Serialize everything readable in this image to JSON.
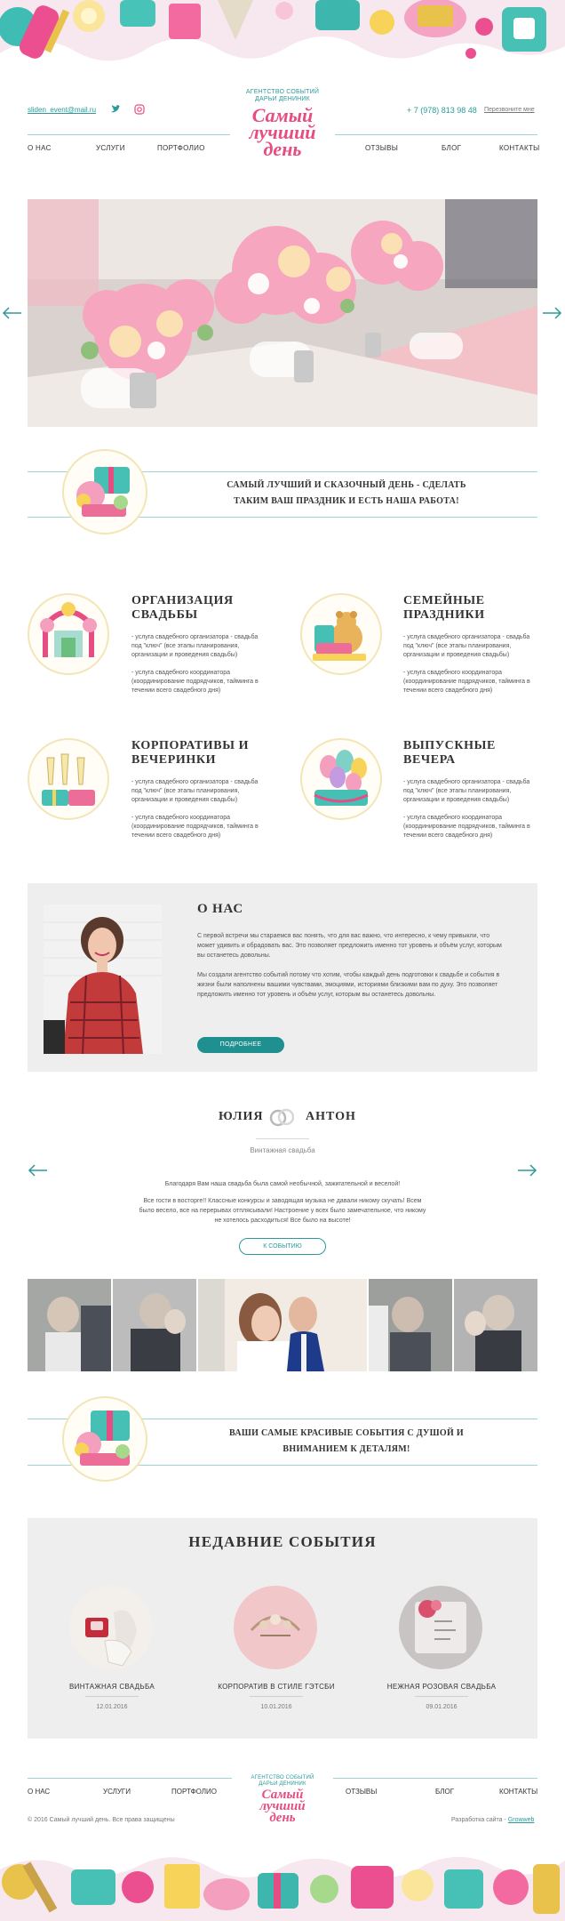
{
  "header": {
    "email": "sliden_event@mail.ru",
    "phone": "+ 7 (978) 813 98 48",
    "callback": "Перезвоните мне",
    "logo_top": "АГЕНТСТВО СОБЫТИЙ",
    "logo_sub": "ДАРЬИ ДЕНИНИК",
    "logo_line1": "Самый",
    "logo_line2": "лучший",
    "logo_line3": "день",
    "nav": [
      "О НАС",
      "УСЛУГИ",
      "ПОРТФОЛИО",
      "ОТЗЫВЫ",
      "БЛОГ",
      "КОНТАКТЫ"
    ]
  },
  "banner1": {
    "line1": "САМЫЙ ЛУЧШИЙ И СКАЗОЧНЫЙ ДЕНЬ - СДЕЛАТЬ",
    "line2": "ТАКИМ ВАШ ПРАЗДНИК И ЕСТЬ НАША РАБОТА!"
  },
  "services": [
    {
      "title1": "ОРГАНИЗАЦИЯ",
      "title2": "СВАДЬБЫ",
      "p1": "- услуга свадебного организатора - свадьба под \"ключ\" (все этапы планирования, организации и проведения свадьбы)",
      "p2": "- услуга свадебного координатора (координирование подрядчиков, тайминга в течении всего свадебного дня)"
    },
    {
      "title1": "СЕМЕЙНЫЕ",
      "title2": "ПРАЗДНИКИ",
      "p1": "- услуга свадебного организатора - свадьба под \"ключ\" (все этапы планирования, организации и проведения свадьбы)",
      "p2": "- услуга свадебного координатора (координирование подрядчиков, тайминга в течении всего свадебного дня)"
    },
    {
      "title1": "КОРПОРАТИВЫ И",
      "title2": "ВЕЧЕРИНКИ",
      "p1": "- услуга свадебного организатора - свадьба под \"ключ\" (все этапы планирования, организации и проведения свадьбы)",
      "p2": "- услуга свадебного координатора (координирование подрядчиков, тайминга в течении всего свадебного дня)"
    },
    {
      "title1": "ВЫПУСКНЫЕ",
      "title2": "ВЕЧЕРА",
      "p1": "- услуга свадебного организатора - свадьба под \"ключ\" (все этапы планирования, организации и проведения свадьбы)",
      "p2": "- услуга свадебного координатора (координирование подрядчиков, тайминга в течении всего свадебного дня)"
    }
  ],
  "about": {
    "title": "О НАС",
    "p1": "С первой встречи мы стараемся вас понять, что для вас важно, что интересно, к чему привыкли, что может удивить и обрадовать вас. Это позволяет предложить именно тот уровень и объём услуг, которым вы останетесь довольны.",
    "p2": "Мы создали агентство событий потому что хотим, чтобы каждый день подготовки к свадьбе и события в жизни были наполнены вашими чувствами, эмоциями, историями близкими вам по духу. Это позволяет предложить именно тот уровень и объём услуг, которым вы останетесь довольны.",
    "button": "ПОДРОБНЕЕ"
  },
  "testimonial": {
    "name1": "ЮЛИЯ",
    "name2": "АНТОН",
    "subtitle": "Винтажная свадьба",
    "p1": "Благодаря Вам наша свадьба была самой необычной, зажигательной и веселой!",
    "p2": "Все гости в восторге!! Классные конкурсы и заводящая музыка не давали никому скучать! Всем было весело, все на перерывах отплясывали! Настроение у всех было замечательное, что никому не хотелось расходиться! Все было на высоте!",
    "button": "К СОБЫТИЮ"
  },
  "banner2": {
    "line1": "ВАШИ САМЫЕ КРАСИВЫЕ СОБЫТИЯ С ДУШОЙ И",
    "line2": "ВНИМАНИЕМ К ДЕТАЛЯМ!"
  },
  "recent": {
    "title": "НЕДАВНИЕ СОБЫТИЯ",
    "events": [
      {
        "name": "ВИНТАЖНАЯ СВАДЬБА",
        "date": "12.01.2016"
      },
      {
        "name": "КОРПОРАТИВ В СТИЛЕ ГЭТСБИ",
        "date": "10.01.2016"
      },
      {
        "name": "НЕЖНАЯ РОЗОВАЯ СВАДЬБА",
        "date": "09.01.2016"
      }
    ]
  },
  "footer": {
    "copyright": "© 2016 Самый лучший день. Все права защищены",
    "dev_label": "Разработка сайта -",
    "dev_name": "Growweb"
  },
  "colors": {
    "accent": "#2a9a9a",
    "pink": "#e64d82",
    "panel": "#efeeee"
  }
}
